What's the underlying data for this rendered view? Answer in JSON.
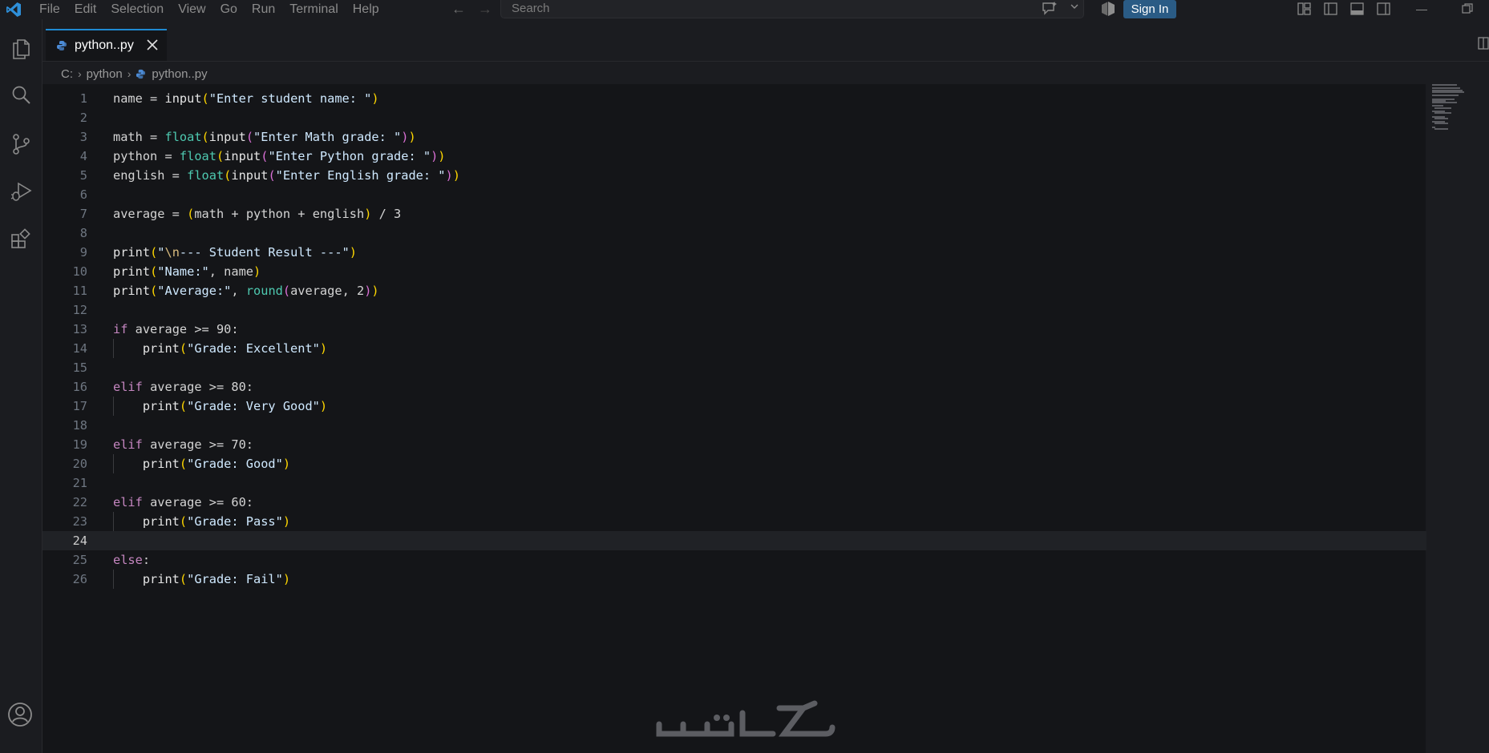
{
  "menu": [
    "File",
    "Edit",
    "Selection",
    "View",
    "Go",
    "Run",
    "Terminal",
    "Help"
  ],
  "search": {
    "placeholder": "Search"
  },
  "titlebar": {
    "signin_label": "Sign In"
  },
  "tab": {
    "label": "python..py"
  },
  "breadcrumb": {
    "drive": "C:",
    "folder": "python",
    "file": "python..py"
  },
  "editor": {
    "current_line": 24,
    "line_numbers": [
      "1",
      "2",
      "3",
      "4",
      "5",
      "6",
      "7",
      "8",
      "9",
      "10",
      "11",
      "12",
      "13",
      "14",
      "15",
      "16",
      "17",
      "18",
      "19",
      "20",
      "21",
      "22",
      "23",
      "24",
      "25",
      "26"
    ],
    "lines": [
      "name = input(\"Enter student name: \")",
      "",
      "math = float(input(\"Enter Math grade: \"))",
      "python = float(input(\"Enter Python grade: \"))",
      "english = float(input(\"Enter English grade: \"))",
      "",
      "average = (math + python + english) / 3",
      "",
      "print(\"\\n--- Student Result ---\")",
      "print(\"Name:\", name)",
      "print(\"Average:\", round(average, 2))",
      "",
      "if average >= 90:",
      "    print(\"Grade: Excellent\")",
      "",
      "elif average >= 80:",
      "    print(\"Grade: Very Good\")",
      "",
      "elif average >= 70:",
      "    print(\"Grade: Good\")",
      "",
      "elif average >= 60:",
      "    print(\"Grade: Pass\")",
      "",
      "else:",
      "    print(\"Grade: Fail\")"
    ]
  },
  "watermark": {
    "text": "خمسات"
  },
  "icons": {
    "explorer": "files-icon",
    "search": "search-icon",
    "scm": "source-control-icon",
    "debug": "run-debug-icon",
    "extensions": "extensions-icon",
    "account": "account-icon"
  },
  "colors": {
    "accent": "#1f8ad2",
    "signin_bg": "#2a5b85",
    "editor_bg": "#141518",
    "chrome_bg": "#1b1c20"
  }
}
